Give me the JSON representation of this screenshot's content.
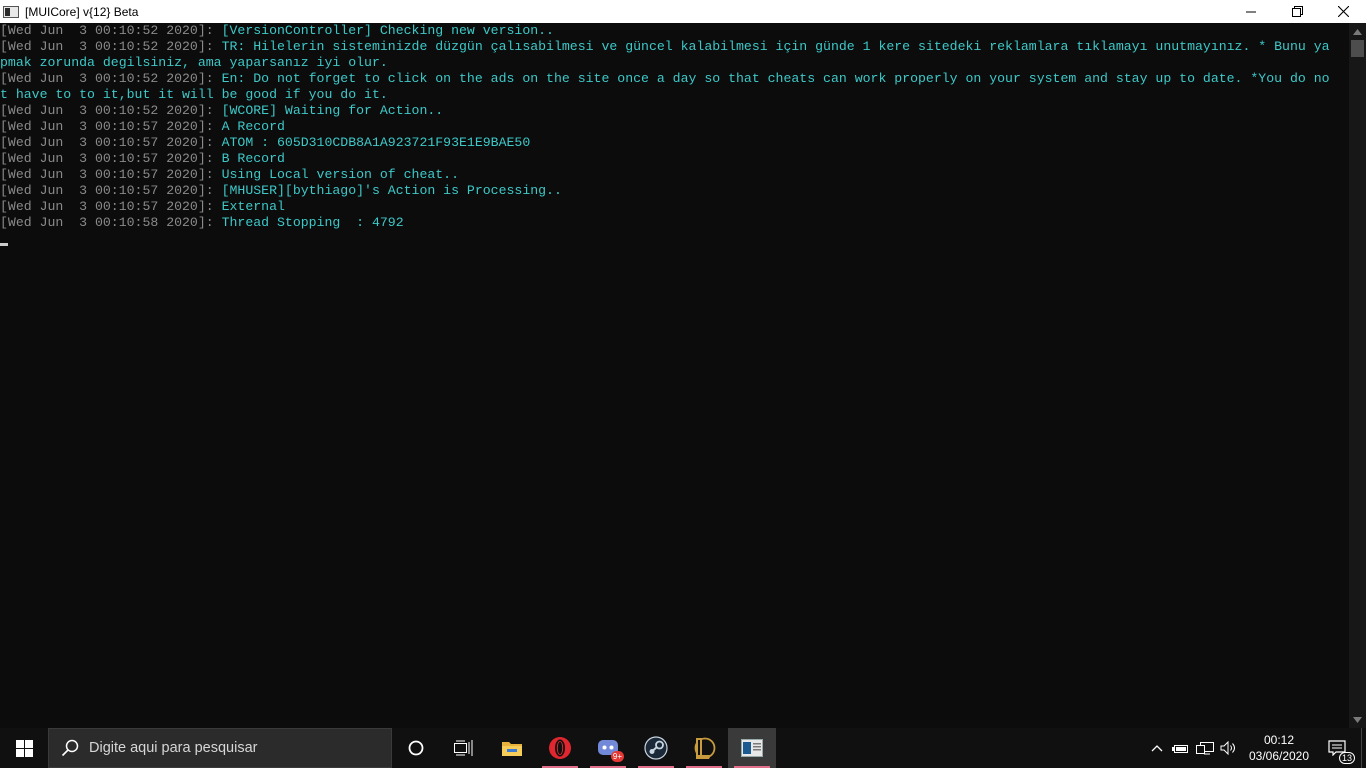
{
  "window": {
    "title": "[MUICore] v{12} Beta"
  },
  "console": {
    "text_color": "#3ec8c8",
    "timestamp_color": "#8a8a8a",
    "lines": [
      {
        "ts": "[Wed Jun  3 00:10:52 2020]: ",
        "msg": "[VersionController] Checking new version.."
      },
      {
        "ts": "[Wed Jun  3 00:10:52 2020]: ",
        "msg": "TR: Hilelerin sisteminizde düzgün çalısabilmesi ve güncel kalabilmesi için günde 1 kere sitedeki reklamlara tıklamayı unutmayınız. * Bunu ya"
      },
      {
        "ts": "",
        "msg": "pmak zorunda degilsiniz, ama yaparsanız iyi olur."
      },
      {
        "ts": "[Wed Jun  3 00:10:52 2020]: ",
        "msg": "En: Do not forget to click on the ads on the site once a day so that cheats can work properly on your system and stay up to date. *You do no"
      },
      {
        "ts": "",
        "msg": "t have to to it,but it will be good if you do it."
      },
      {
        "ts": "[Wed Jun  3 00:10:52 2020]: ",
        "msg": "[WCORE] Waiting for Action.."
      },
      {
        "ts": "[Wed Jun  3 00:10:57 2020]: ",
        "msg": "A Record"
      },
      {
        "ts": "[Wed Jun  3 00:10:57 2020]: ",
        "msg": "ATOM : 605D310CDB8A1A923721F93E1E9BAE50"
      },
      {
        "ts": "[Wed Jun  3 00:10:57 2020]: ",
        "msg": "B Record"
      },
      {
        "ts": "[Wed Jun  3 00:10:57 2020]: ",
        "msg": "Using Local version of cheat.."
      },
      {
        "ts": "[Wed Jun  3 00:10:57 2020]: ",
        "msg": "[MHUSER][bythiago]'s Action is Processing.."
      },
      {
        "ts": "[Wed Jun  3 00:10:57 2020]: ",
        "msg": "External"
      },
      {
        "ts": "[Wed Jun  3 00:10:58 2020]: ",
        "msg": "Thread Stopping  : 4792"
      }
    ]
  },
  "taskbar": {
    "search_placeholder": "Digite aqui para pesquisar",
    "apps": [
      {
        "name": "cortana-icon"
      },
      {
        "name": "task-view-icon"
      },
      {
        "name": "file-explorer-icon"
      },
      {
        "name": "opera-icon"
      },
      {
        "name": "discord-icon",
        "badge": "9+"
      },
      {
        "name": "steam-icon"
      },
      {
        "name": "league-of-legends-icon"
      },
      {
        "name": "console-app-icon",
        "active": true
      }
    ],
    "clock": {
      "time": "00:12",
      "date": "03/06/2020"
    },
    "notification_count": "13",
    "accent_color": "#e26f8a"
  }
}
